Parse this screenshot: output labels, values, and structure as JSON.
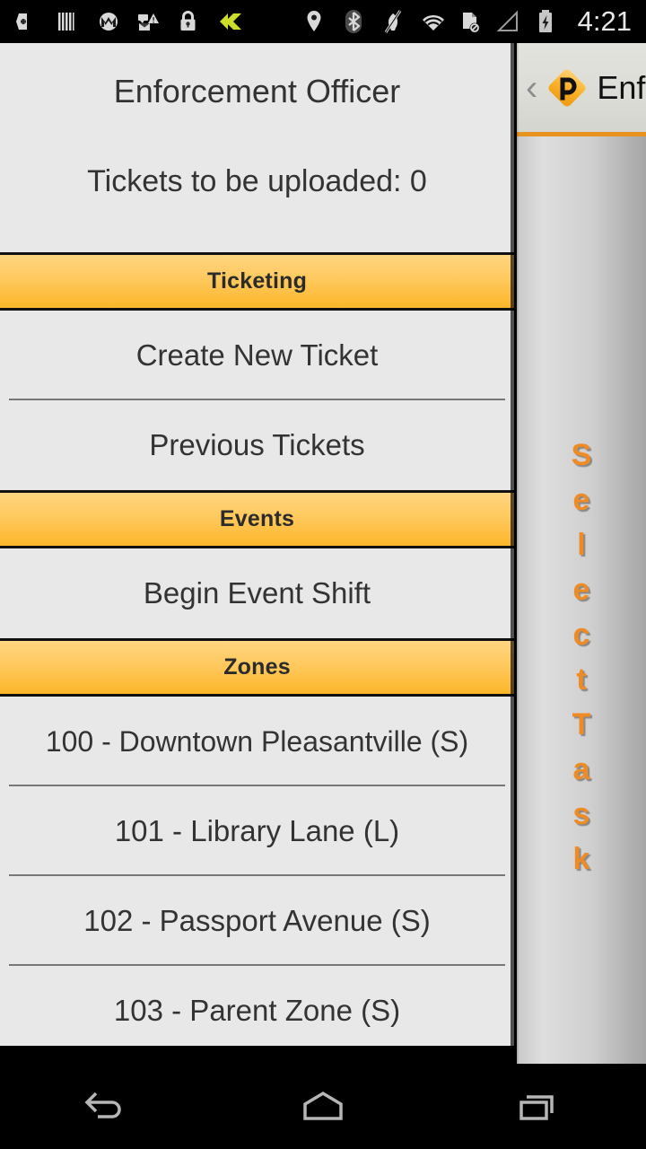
{
  "status_bar": {
    "time": "4:21",
    "left_icons": [
      "sd-card-plus-icon",
      "barcode-icon",
      "motorola-icon",
      "message-warning-icon",
      "lock-icon",
      "zello-icon"
    ],
    "right_icons": [
      "location-pin-icon",
      "bluetooth-icon",
      "mute-icon",
      "wifi-icon",
      "no-sim-icon",
      "signal-icon",
      "battery-charging-icon"
    ]
  },
  "main_panel": {
    "title": "Enforcement Officer",
    "upload_status": "Tickets to be uploaded: 0",
    "sections": [
      {
        "header": "Ticketing",
        "items": [
          "Create New Ticket",
          "Previous Tickets"
        ]
      },
      {
        "header": "Events",
        "items": [
          "Begin Event Shift"
        ]
      },
      {
        "header": "Zones",
        "items": [
          "100 - Downtown Pleasantville (S)",
          "101 - Library Lane (L)",
          "102 - Passport Avenue (S)",
          "103 - Parent Zone (S)"
        ]
      }
    ]
  },
  "drawer": {
    "back_chevron": "‹",
    "logo": "passport-p-logo-icon",
    "title": "Enf",
    "vertical_label": "Select Task",
    "vertical_label_chars": [
      "S",
      "e",
      "l",
      "e",
      "c",
      "t",
      " ",
      "T",
      "a",
      "s",
      "k"
    ]
  },
  "nav_bar": {
    "buttons": [
      "back-button",
      "home-button",
      "recents-button"
    ]
  },
  "colors": {
    "accent_orange": "#FCB629",
    "header_gradient_top": "#FFD581",
    "header_gradient_bottom": "#FCB629",
    "panel_background": "#E8E8E8",
    "text_primary": "#333333",
    "drawer_accent": "#E8921F",
    "vertical_label_color": "#EF8B24",
    "status_bar_background": "#000000"
  }
}
